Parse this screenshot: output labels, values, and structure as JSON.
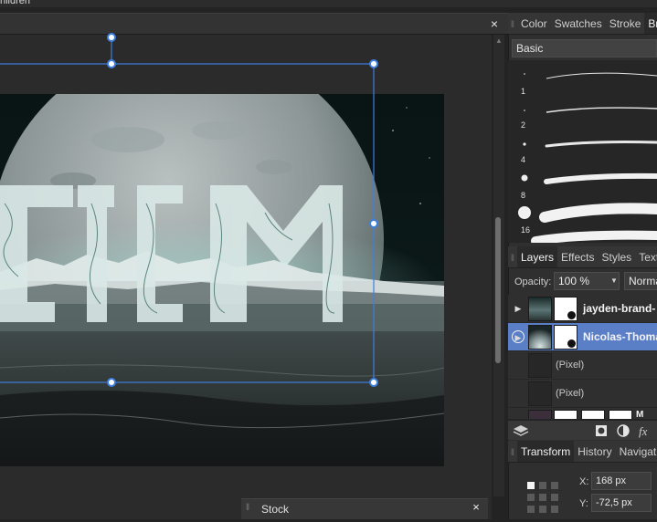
{
  "window": {
    "title_partial": "hildren"
  },
  "document": {
    "close_label": "×"
  },
  "stock": {
    "label": "Stock",
    "close_label": "×"
  },
  "brushes": {
    "tabs": [
      "Color",
      "Swatches",
      "Stroke",
      "Br"
    ],
    "active_tab": "Br",
    "category": "Basic",
    "sizes": [
      "1",
      "2",
      "4",
      "8",
      "16"
    ]
  },
  "layers": {
    "tabs": [
      "Layers",
      "Effects",
      "Styles",
      "Text"
    ],
    "active_tab": "Layers",
    "opacity_label": "Opacity:",
    "opacity_value": "100 %",
    "blend_mode": "Normal",
    "items": [
      {
        "name": "jayden-brand-",
        "selected": false
      },
      {
        "name": "Nicolas-Thoma",
        "selected": true
      },
      {
        "name": "(Pixel)"
      },
      {
        "name": "(Pixel)"
      },
      {
        "name": "M"
      }
    ]
  },
  "transform": {
    "tabs": [
      "Transform",
      "History",
      "Navigat"
    ],
    "active_tab": "Transform",
    "x_label": "X:",
    "x_value": "168 px",
    "y_label": "Y:",
    "y_value": "-72,5 px"
  },
  "colors": {
    "selection": "#3f7fe0",
    "layer_selected": "#5b7fc7",
    "panel_bg": "#2f2f2f",
    "canvas_bg": "#2b2b2b"
  },
  "icons": [
    "grip-icon",
    "close-icon",
    "expand-arrow-icon",
    "dropdown-arrow-icon",
    "layers-stack-icon",
    "mask-icon",
    "adjustment-icon",
    "fx-icon",
    "anchor-grid-icon",
    "scroll-up-icon"
  ]
}
